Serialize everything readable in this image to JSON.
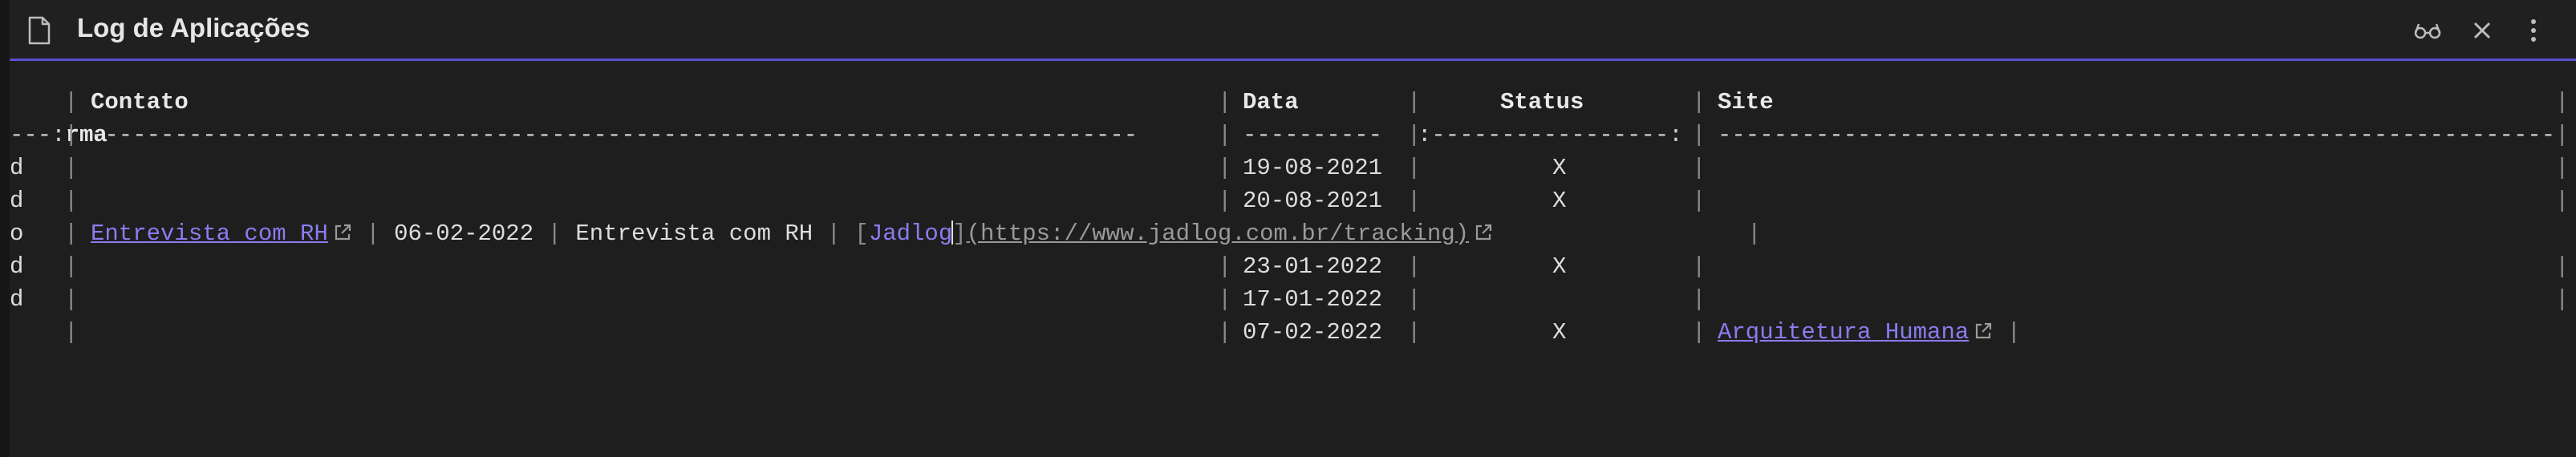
{
  "window": {
    "title": "Log de Aplicações",
    "icons": [
      "file-icon",
      "reading-view-icon",
      "close-icon",
      "more-options-icon"
    ]
  },
  "table": {
    "headers": {
      "col_forma_partial": "rma",
      "contato": "Contato",
      "data": "Data",
      "status": "Status",
      "site": "Site"
    },
    "align_row": {
      "forma_partial": "---:",
      "contato": "---------------------------------------------------------------------------",
      "data": "----------",
      "status": ":-----------------:",
      "site": "-----------------------------------------------------------------------"
    },
    "rows": [
      {
        "forma_partial": "d",
        "data": "19-08-2021",
        "status": "X"
      },
      {
        "forma_partial": "d",
        "data": "20-08-2021",
        "status": "X"
      },
      {
        "forma_partial": "o",
        "raw": {
          "link_text": "Entrevista com RH",
          "date": "06-02-2022",
          "text": "Entrevista com RH",
          "md_link_text": "Jadlog",
          "md_link_url": "(https://www.jadlog.com.br/tracking)"
        }
      },
      {
        "forma_partial": "d",
        "data": "23-01-2022",
        "status": "X"
      },
      {
        "forma_partial": "d",
        "data": "17-01-2022",
        "status": ""
      },
      {
        "forma_partial": "",
        "data": "07-02-2022",
        "status": "X",
        "site": "Arquitetura Humana"
      }
    ]
  },
  "colors": {
    "accent": "#5a4fcf",
    "link": "#8a7cf0",
    "background": "#1e1e1e"
  }
}
